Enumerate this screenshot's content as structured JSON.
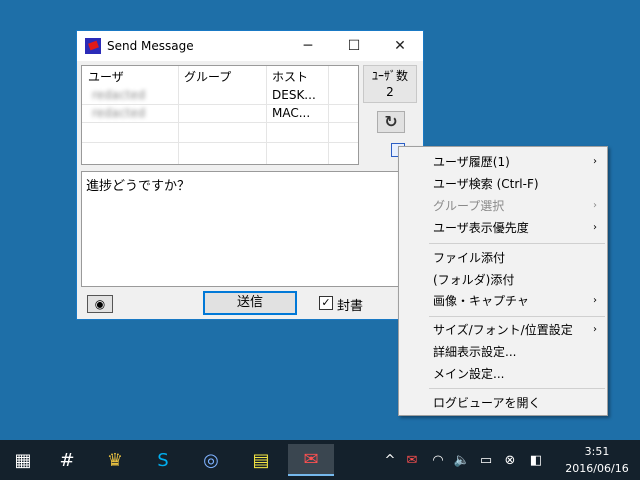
{
  "window": {
    "title": "Send Message",
    "min_icon": "─",
    "max_icon": "☐",
    "close_icon": "✕"
  },
  "user_table": {
    "columns": [
      "ユーザ",
      "グループ",
      "ホスト"
    ],
    "rows": [
      {
        "user": "redacted",
        "group": "",
        "host": "DESK..."
      },
      {
        "user": "redacted",
        "group": "",
        "host": "MAC..."
      }
    ]
  },
  "user_count": {
    "label": "ﾕｰｻﾞ数",
    "value": "2"
  },
  "refresh_icon": "↻",
  "message_text": "進捗どうですか？",
  "attach_icon": "◉",
  "send_label": "送信",
  "seal": {
    "checked": true,
    "mark": "✓",
    "label": "封書"
  },
  "menu": {
    "items": [
      {
        "label": "ユーザ履歴(1)",
        "submenu": true,
        "disabled": false
      },
      {
        "label": "ユーザ検索 (Ctrl-F)",
        "submenu": false,
        "disabled": false
      },
      {
        "label": "グループ選択",
        "submenu": true,
        "disabled": true
      },
      {
        "label": "ユーザ表示優先度",
        "submenu": true,
        "disabled": false
      },
      {
        "label": "ファイル添付",
        "submenu": false,
        "disabled": false
      },
      {
        "label": "(フォルダ)添付",
        "submenu": false,
        "disabled": false
      },
      {
        "label": "画像・キャプチャ",
        "submenu": true,
        "disabled": false
      },
      {
        "label": "サイズ/フォント/位置設定",
        "submenu": true,
        "disabled": false
      },
      {
        "label": "詳細表示設定...",
        "submenu": false,
        "disabled": false
      },
      {
        "label": "メイン設定...",
        "submenu": false,
        "disabled": false
      },
      {
        "label": "ログビューアを開く",
        "submenu": false,
        "disabled": false
      }
    ],
    "arrow": "›"
  },
  "taskbar": {
    "apps": [
      {
        "name": "calculator-icon",
        "glyph": "▦"
      },
      {
        "name": "slack-icon",
        "glyph": "#"
      },
      {
        "name": "crest-icon",
        "glyph": "♛"
      },
      {
        "name": "skype-icon",
        "glyph": "S"
      },
      {
        "name": "globe-icon",
        "glyph": "◎"
      },
      {
        "name": "notepad-icon",
        "glyph": "▤"
      },
      {
        "name": "ipmsg-icon",
        "glyph": "✉"
      }
    ],
    "tray": {
      "chevron": "^",
      "network": "◠",
      "volume": "🔈",
      "notes": "▭",
      "block": "⊗",
      "app": "◧"
    },
    "time": "3:51",
    "date": "2016/06/16"
  }
}
